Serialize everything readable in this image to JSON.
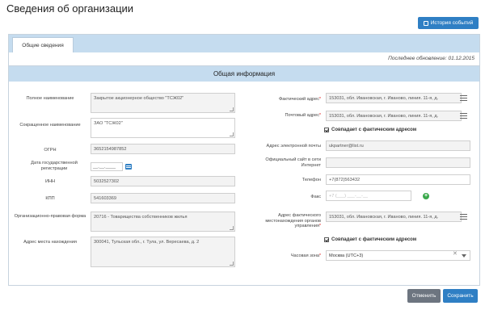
{
  "page": {
    "title": "Сведения об организации"
  },
  "toolbar": {
    "history_label": "История событий"
  },
  "tabs": [
    {
      "label": "Общие сведения"
    }
  ],
  "last_update": "Последнее обновление: 01.12.2015",
  "section": {
    "title": "Общая информация"
  },
  "left": {
    "full_name": {
      "label": "Полное наименование",
      "value": "Закрытое акционерное общество \"ТСЖ02\""
    },
    "short_name": {
      "label": "Сокращенное наименование",
      "value": "ЗАО \"ТСЖ02\""
    },
    "ogrn": {
      "label": "ОГРН",
      "value": "3652154987852"
    },
    "reg_date": {
      "label": "Дата государственной регистрации",
      "value": "__.__.____"
    },
    "inn": {
      "label": "ИНН",
      "value": "5032527302"
    },
    "kpp": {
      "label": "КПП",
      "value": "541603369"
    },
    "legal_form": {
      "label": "Организационно-правовая форма",
      "value": "20716 - Товарищества собственников жилья"
    },
    "location": {
      "label": "Адрес места нахождения",
      "value": "300041, Тульская обл., г. Тула, ул. Вересаева, д. 2"
    }
  },
  "right": {
    "actual_address": {
      "label": "Фактический адрес",
      "value": "153031, обл. Ивановская, г. Иваново, линия. 11-я, д."
    },
    "postal_address": {
      "label": "Почтовый адрес",
      "value": "153031, обл. Ивановская, г. Иваново, линия. 11-я, д."
    },
    "same_as_actual_1": {
      "label": "Совпадает с фактическим адресом"
    },
    "email": {
      "label": "Адрес электронной почты",
      "value": "ukpartner@list.ru"
    },
    "website": {
      "label": "Официальный сайт в сети Интернет",
      "value": ""
    },
    "phone": {
      "label": "Телефон",
      "value": "+7(872)563432"
    },
    "fax": {
      "label": "Факс",
      "value": "+7 (___) ___-__-__"
    },
    "mgmt_address": {
      "label": "Адрес фактического местонахождения органов управления",
      "value": "153031, обл. Ивановская, г. Иваново, линия. 11-я, д."
    },
    "same_as_actual_2": {
      "label": "Совпадает с фактическим адресом"
    },
    "timezone": {
      "label": "Часовая зона",
      "value": "Москва (UTC+3)"
    }
  },
  "footer": {
    "cancel_label": "Отменить",
    "save_label": "Сохранить"
  },
  "icons": {
    "history": "list-icon",
    "calendar": "calendar-icon",
    "menu": "hamburger-icon",
    "add": "plus-icon",
    "clear": "close-icon",
    "dropdown": "chevron-down-icon"
  },
  "colors": {
    "accent": "#2f7fc4",
    "header_bg": "#c5dcef",
    "add": "#3aa84b",
    "cancel": "#6d7580",
    "required": "#dd0000"
  }
}
